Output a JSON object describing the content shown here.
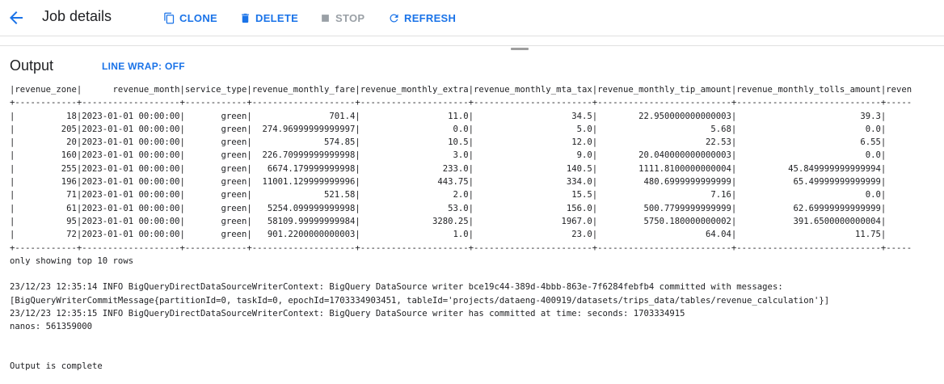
{
  "header": {
    "title": "Job details",
    "back_icon": "arrow-left-icon",
    "actions": {
      "clone": "CLONE",
      "delete": "DELETE",
      "stop": "STOP",
      "refresh": "REFRESH"
    }
  },
  "output": {
    "title": "Output",
    "line_wrap": "LINE WRAP: OFF",
    "log_lines": [
      "|revenue_zone|      revenue_month|service_type|revenue_monthly_fare|revenue_monthly_extra|revenue_monthly_mta_tax|revenue_monthly_tip_amount|revenue_monthly_tolls_amount|reven",
      "+------------+-------------------+------------+--------------------+---------------------+-----------------------+--------------------------+----------------------------+-----",
      "|          18|2023-01-01 00:00:00|       green|               701.4|                 11.0|                   34.5|        22.950000000000003|                        39.3|",
      "|         205|2023-01-01 00:00:00|       green|  274.96999999999997|                  0.0|                    5.0|                      5.68|                         0.0|",
      "|          20|2023-01-01 00:00:00|       green|              574.85|                 10.5|                   12.0|                     22.53|                        6.55|",
      "|         160|2023-01-01 00:00:00|       green|  226.70999999999998|                  3.0|                    9.0|        20.040000000000003|                         0.0|",
      "|         255|2023-01-01 00:00:00|       green|   6674.179999999998|                233.0|                  140.5|        1111.8100000000004|          45.849999999999994|",
      "|         196|2023-01-01 00:00:00|       green|  11001.129999999996|               443.75|                  334.0|         480.6999999999999|           65.49999999999999|",
      "|          71|2023-01-01 00:00:00|       green|              521.58|                  2.0|                   15.5|                      7.16|                         0.0|",
      "|          61|2023-01-01 00:00:00|       green|   5254.099999999998|                 53.0|                  156.0|         500.7799999999999|           62.69999999999999|",
      "|          95|2023-01-01 00:00:00|       green|   58109.99999999984|              3280.25|                 1967.0|         5750.180000000002|           391.6500000000004|",
      "|          72|2023-01-01 00:00:00|       green|   901.2200000000003|                  1.0|                   23.0|                     64.04|                       11.75|",
      "+------------+-------------------+------------+--------------------+---------------------+-----------------------+--------------------------+----------------------------+-----",
      "only showing top 10 rows",
      "",
      "23/12/23 12:35:14 INFO BigQueryDirectDataSourceWriterContext: BigQuery DataSource writer bce19c44-389d-4bbb-863e-7f6284febfb4 committed with messages:",
      "[BigQueryWriterCommitMessage{partitionId=0, taskId=0, epochId=1703334903451, tableId='projects/dataeng-400919/datasets/trips_data/tables/revenue_calculation'}]",
      "23/12/23 12:35:15 INFO BigQueryDirectDataSourceWriterContext: BigQuery DataSource writer has committed at time: seconds: 1703334915",
      "nanos: 561359000",
      "",
      "",
      "Output is complete"
    ]
  },
  "colors": {
    "accent": "#1a73e8",
    "disabled": "#9aa0a6",
    "text": "#202124"
  }
}
